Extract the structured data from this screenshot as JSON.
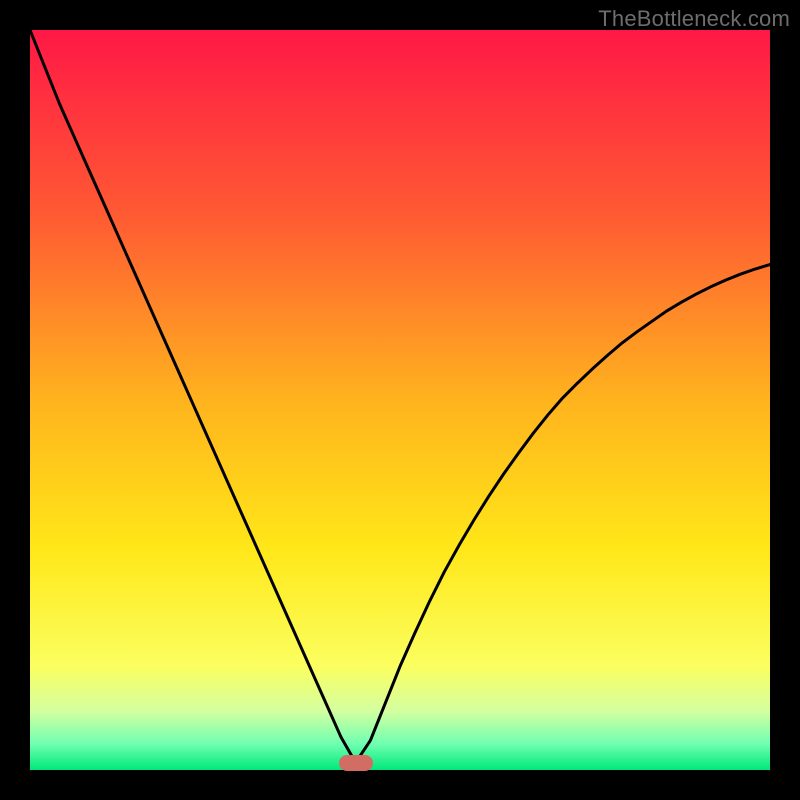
{
  "watermark": "TheBottleneck.com",
  "chart_data": {
    "type": "line",
    "title": "",
    "xlabel": "",
    "ylabel": "",
    "xlim": [
      0,
      100
    ],
    "ylim": [
      0,
      100
    ],
    "gradient": [
      {
        "offset": 0.0,
        "color": "#ff1846"
      },
      {
        "offset": 0.25,
        "color": "#ff5a33"
      },
      {
        "offset": 0.5,
        "color": "#ffb31e"
      },
      {
        "offset": 0.7,
        "color": "#ffe718"
      },
      {
        "offset": 0.86,
        "color": "#fbff60"
      },
      {
        "offset": 0.92,
        "color": "#d4ffa0"
      },
      {
        "offset": 0.965,
        "color": "#6fffb0"
      },
      {
        "offset": 1.0,
        "color": "#00e87a"
      }
    ],
    "curve_color": "#000000",
    "marker": {
      "x": 44,
      "y": 1.0,
      "color": "#d16d62"
    },
    "x": [
      0,
      2,
      4,
      6,
      8,
      10,
      12,
      14,
      16,
      18,
      20,
      22,
      24,
      26,
      28,
      30,
      32,
      34,
      36,
      38,
      40,
      42,
      44,
      46,
      48,
      50,
      52,
      54,
      56,
      58,
      60,
      62,
      64,
      66,
      68,
      70,
      72,
      74,
      76,
      78,
      80,
      82,
      84,
      86,
      88,
      90,
      92,
      94,
      96,
      98,
      100
    ],
    "values": [
      100,
      95,
      90,
      85.5,
      81,
      76.5,
      72,
      67.5,
      63,
      58.5,
      54,
      49.5,
      45,
      40.5,
      36,
      31.5,
      27,
      22.5,
      18,
      13.5,
      9,
      4.5,
      1,
      4,
      9,
      14,
      18.5,
      22.8,
      26.8,
      30.4,
      33.8,
      37,
      40,
      42.8,
      45.5,
      48,
      50.3,
      52.3,
      54.2,
      56,
      57.7,
      59.2,
      60.6,
      62,
      63.2,
      64.3,
      65.3,
      66.2,
      67,
      67.7,
      68.3
    ]
  }
}
